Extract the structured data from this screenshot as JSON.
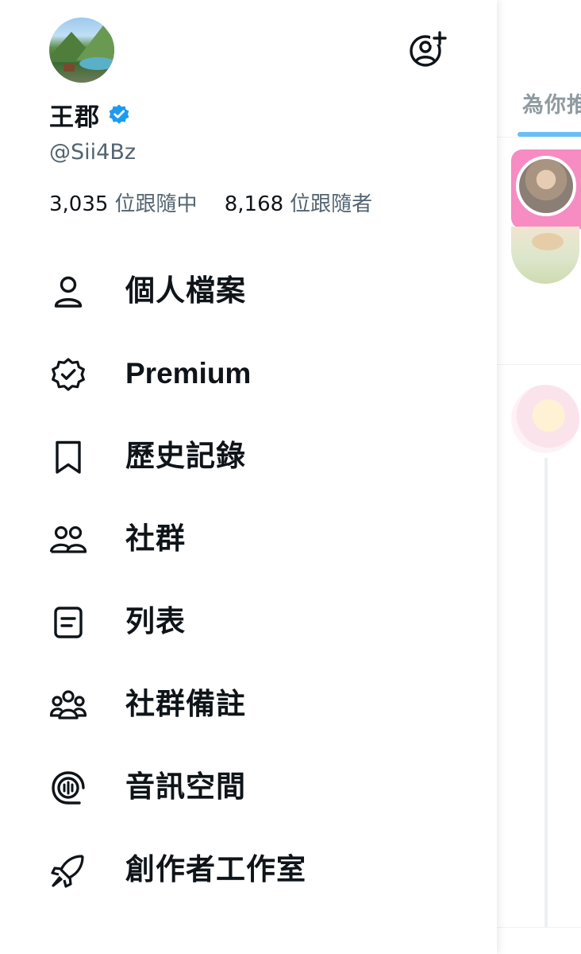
{
  "timeline": {
    "tab_label": "為你推",
    "accent": "#1d9bf0",
    "story_ring_color": "#f24fa0"
  },
  "profile": {
    "display_name": "王郡",
    "handle": "@Sii4Bz",
    "verified": true,
    "verified_color": "#1d9bf0",
    "following_count": "3,035",
    "following_label": "位跟隨中",
    "followers_count": "8,168",
    "followers_label": "位跟隨者"
  },
  "header": {
    "add_account_icon": "add-account-icon"
  },
  "menu": {
    "items": [
      {
        "label": "個人檔案",
        "icon": "person-icon"
      },
      {
        "label": "Premium",
        "icon": "premium-badge-icon"
      },
      {
        "label": "歷史記錄",
        "icon": "bookmark-icon"
      },
      {
        "label": "社群",
        "icon": "communities-icon"
      },
      {
        "label": "列表",
        "icon": "list-icon"
      },
      {
        "label": "社群備註",
        "icon": "community-notes-icon"
      },
      {
        "label": "音訊空間",
        "icon": "spaces-icon"
      },
      {
        "label": "創作者工作室",
        "icon": "rocket-icon"
      }
    ]
  }
}
